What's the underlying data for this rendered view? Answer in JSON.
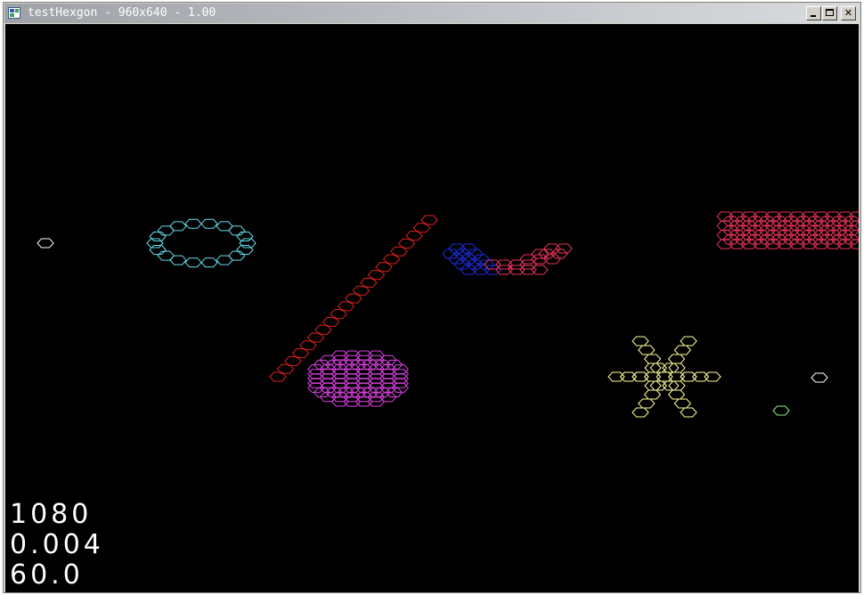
{
  "window": {
    "title": "testHexgon - 960x640 - 1.00",
    "icon": "app-window-icon",
    "buttons": [
      {
        "name": "minimize",
        "icon": "minimize-icon"
      },
      {
        "name": "maximize",
        "icon": "maximize-icon"
      },
      {
        "name": "close",
        "icon": "close-icon",
        "label": "✕"
      }
    ]
  },
  "stats": {
    "line1": "1080",
    "line2": "0.004",
    "line3": "60.0"
  },
  "colors": {
    "background": "#000000",
    "white": "#ffffff",
    "cyan": "#66ddee",
    "red": "#e02020",
    "crimson": "#e8335a",
    "blue": "#1c2ee0",
    "magenta": "#e040e8",
    "yellow": "#ffff99",
    "green": "#88ee88"
  }
}
